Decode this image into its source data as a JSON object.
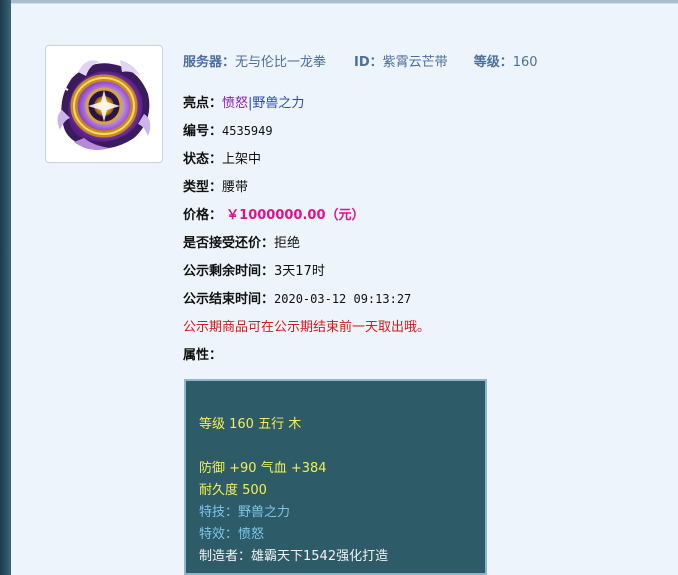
{
  "header": {
    "server_label": "服务器：",
    "server_value": "无与伦比一龙拳",
    "id_label": "ID：",
    "id_value": "紫霄云芒带",
    "level_label": "等级：",
    "level_value": "160"
  },
  "icon": {
    "name": "belt-item-icon"
  },
  "highlights": {
    "label": "亮点：",
    "tag1": "愤怒",
    "separator": "|",
    "tag2": "野兽之力"
  },
  "serial": {
    "label": "编号：",
    "value": "4535949"
  },
  "status": {
    "label": "状态：",
    "value": "上架中"
  },
  "type": {
    "label": "类型：",
    "value": "腰带"
  },
  "price": {
    "label": "价格：",
    "value": "￥1000000.00（元）"
  },
  "counter_offer": {
    "label": "是否接受还价：",
    "value": "拒绝"
  },
  "public_remaining": {
    "label": "公示剩余时间：",
    "value": "3天17时"
  },
  "public_end": {
    "label": "公示结束时间：",
    "value": "2020-03-12 09:13:27"
  },
  "notice": "公示期商品可在公示期结束前一天取出哦。",
  "attributes_label": "属性：",
  "attributes": {
    "level_line": "等级 160 五行 木",
    "stats_line": "防御 +90 气血 +384",
    "durability_line": "耐久度 500",
    "skill_line": "特技：野兽之力",
    "effect_line": "特效：愤怒",
    "maker_line": "制造者：雄霸天下1542强化打造"
  },
  "colors": {
    "header_text": "#4c6f9d",
    "price": "#e01090",
    "notice": "#d41a1a",
    "highlight_purple": "#8c1fb2",
    "highlight_blue": "#2848c8",
    "attr_bg": "#2e5b68",
    "attr_yellow": "#f2ef55",
    "attr_lightblue": "#7bc7ea"
  }
}
